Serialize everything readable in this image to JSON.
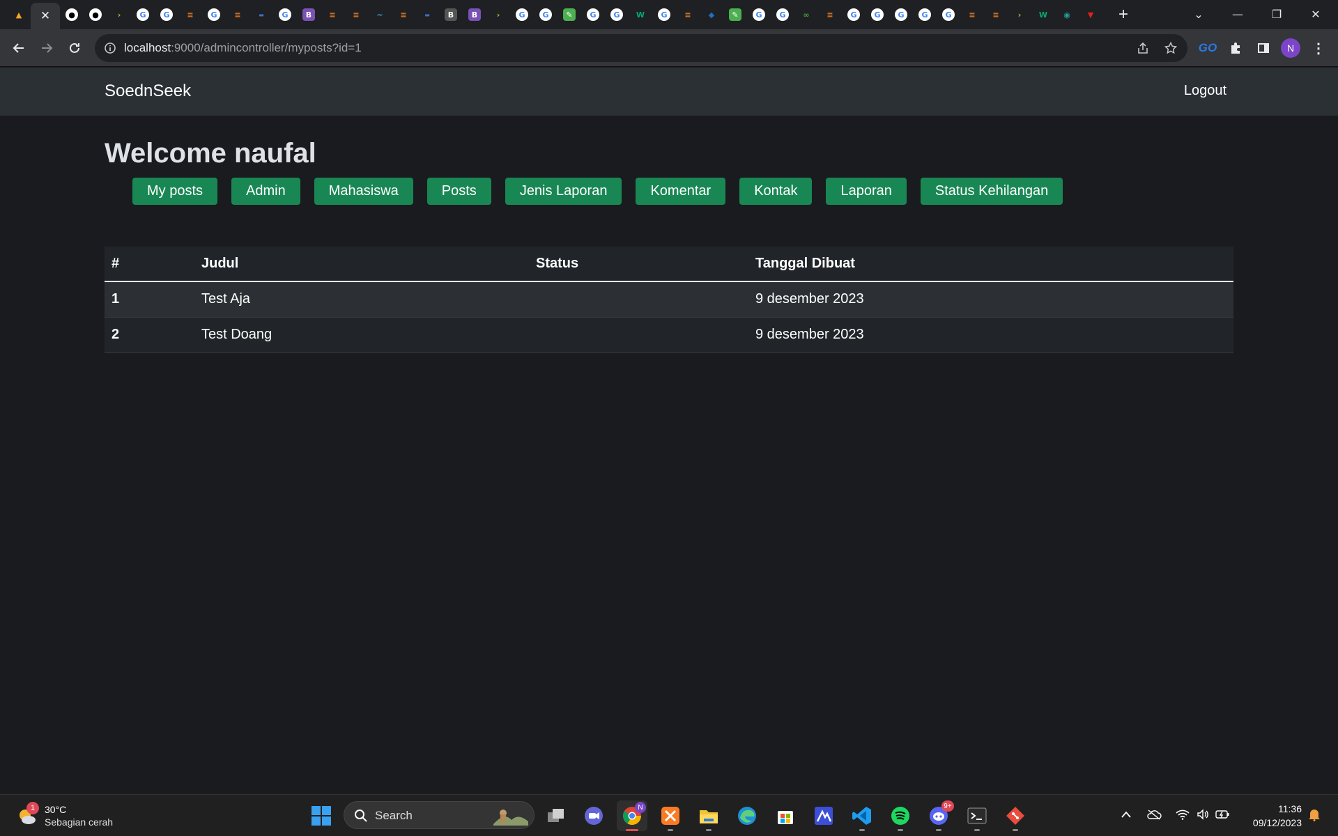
{
  "browser": {
    "active_tab_close": "✕",
    "new_tab": "+",
    "url_host": "localhost",
    "url_rest": ":9000/admincontroller/myposts?id=1",
    "profile_initial": "N",
    "window_controls": {
      "dropdown": "⌄",
      "minimize": "—",
      "restore": "❐",
      "close": "✕"
    }
  },
  "app": {
    "brand": "SoednSeek",
    "logout": "Logout",
    "welcome": "Welcome naufal",
    "nav_buttons": [
      "My posts",
      "Admin",
      "Mahasiswa",
      "Posts",
      "Jenis Laporan",
      "Komentar",
      "Kontak",
      "Laporan",
      "Status Kehilangan"
    ],
    "accent": "#198754"
  },
  "table": {
    "headers": [
      "#",
      "Judul",
      "Status",
      "Tanggal Dibuat"
    ],
    "rows": [
      {
        "no": "1",
        "judul": "Test Aja",
        "status": "",
        "tanggal": "9 desember 2023"
      },
      {
        "no": "2",
        "judul": "Test Doang",
        "status": "",
        "tanggal": "9 desember 2023"
      }
    ]
  },
  "taskbar": {
    "weather_temp": "30°C",
    "weather_desc": "Sebagian cerah",
    "weather_badge": "1",
    "search_label": "Search",
    "discord_badge": "9+",
    "time": "11:36",
    "date": "09/12/2023"
  }
}
